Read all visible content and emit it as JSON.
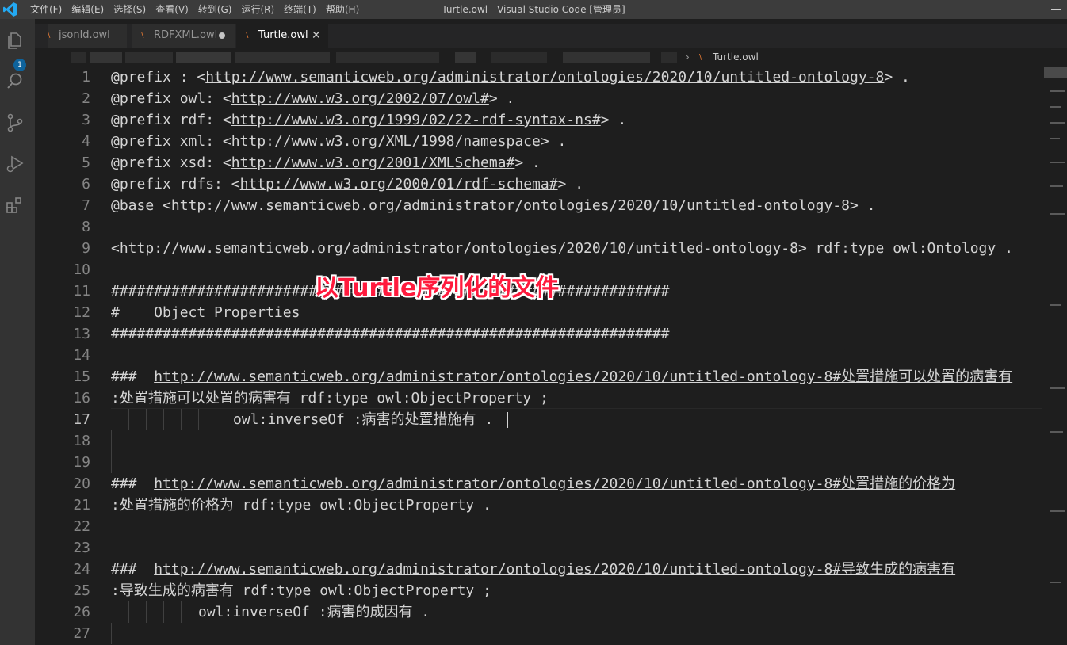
{
  "window": {
    "title": "Turtle.owl - Visual Studio Code [管理员]",
    "menu": [
      "文件(F)",
      "编辑(E)",
      "选择(S)",
      "查看(V)",
      "转到(G)",
      "运行(R)",
      "终端(T)",
      "帮助(H)"
    ]
  },
  "activity": {
    "explorer_badge": "1"
  },
  "tabs": [
    {
      "label": "jsonld.owl",
      "state": "normal"
    },
    {
      "label": "RDFXML.owl",
      "state": "modified"
    },
    {
      "label": "Turtle.owl",
      "state": "active",
      "close": "✕"
    }
  ],
  "breadcrumb": {
    "separator": "›",
    "file": "Turtle.owl"
  },
  "editor": {
    "lines": [
      {
        "num": "1"
      },
      {
        "num": "2"
      },
      {
        "num": "3"
      },
      {
        "num": "4"
      },
      {
        "num": "5"
      },
      {
        "num": "6"
      },
      {
        "num": "7"
      },
      {
        "num": "8"
      },
      {
        "num": "9"
      },
      {
        "num": "10"
      },
      {
        "num": "11"
      },
      {
        "num": "12"
      },
      {
        "num": "13"
      },
      {
        "num": "14"
      },
      {
        "num": "15"
      },
      {
        "num": "16"
      },
      {
        "num": "17"
      },
      {
        "num": "18"
      },
      {
        "num": "19"
      },
      {
        "num": "20"
      },
      {
        "num": "21"
      },
      {
        "num": "22"
      },
      {
        "num": "23"
      },
      {
        "num": "24"
      },
      {
        "num": "25"
      },
      {
        "num": "26"
      },
      {
        "num": "27"
      }
    ],
    "code": {
      "l1_pre": "@prefix : <",
      "l1_proto": "http",
      "l1_url": "://www.semanticweb.org/administrator/ontologies/2020/10/untitled-ontology-8",
      "l1_post": "> .",
      "l2_pre": "@prefix owl: <",
      "l2_proto": "http",
      "l2_url": "://www.w3.org/2002/07/owl#",
      "l2_post": "> .",
      "l3_pre": "@prefix rdf: <",
      "l3_proto": "http",
      "l3_url": "://www.w3.org/1999/02/22-rdf-syntax-ns#",
      "l3_post": "> .",
      "l4_pre": "@prefix xml: <",
      "l4_proto": "http",
      "l4_url": "://www.w3.org/XML/1998/namespace",
      "l4_post": "> .",
      "l5_pre": "@prefix xsd: <",
      "l5_proto": "http",
      "l5_url": "://www.w3.org/2001/XMLSchema#",
      "l5_post": "> .",
      "l6_pre": "@prefix rdfs: <",
      "l6_proto": "http",
      "l6_url": "://www.w3.org/2000/01/rdf-schema#",
      "l6_post": "> .",
      "l7": "@base <http://www.semanticweb.org/administrator/ontologies/2020/10/untitled-ontology-8> .",
      "l9_pre": "<",
      "l9_proto": "http",
      "l9_url": "://www.semanticweb.org/administrator/ontologies/2020/10/untitled-ontology-8",
      "l9_post": "> rdf:type owl:Ontology .",
      "l11": "#################################################################",
      "l12": "#    Object Properties",
      "l13": "#################################################################",
      "l15_pre": "###  ",
      "l15_url": "http://www.semanticweb.org/administrator/ontologies/2020/10/untitled-ontology-8#处置措施可以处置的病害有",
      "l16": ":处置措施可以处置的病害有 rdf:type owl:ObjectProperty ;",
      "l17": "owl:inverseOf :病害的处置措施有 .",
      "l20_pre": "###  ",
      "l20_url": "http://www.semanticweb.org/administrator/ontologies/2020/10/untitled-ontology-8#处置措施的价格为",
      "l21": ":处置措施的价格为 rdf:type owl:ObjectProperty .",
      "l24_pre": "###  ",
      "l24_url": "http://www.semanticweb.org/administrator/ontologies/2020/10/untitled-ontology-8#导致生成的病害有",
      "l25": ":导致生成的病害有 rdf:type owl:ObjectProperty ;",
      "l26": "owl:inverseOf :病害的成因有 ."
    }
  },
  "overlay_caption": "以Turtle序列化的文件",
  "colors": {
    "titlebar": "#3c3c3c",
    "activitybar": "#333333",
    "editor_bg": "#1e1e1e",
    "accent": "#0e639c",
    "link": "#3794ff",
    "overlay": "#ff1a3d"
  }
}
